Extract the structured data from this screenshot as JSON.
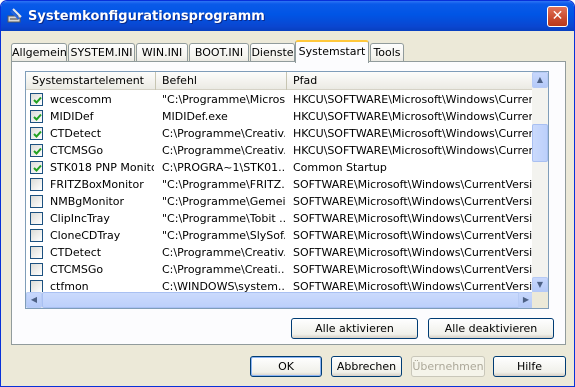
{
  "window": {
    "title": "Systemkonfigurationsprogramm",
    "close_icon": "close-icon",
    "app_icon": "msconfig-icon"
  },
  "tabs": [
    {
      "label": "Allgemein",
      "active": false
    },
    {
      "label": "SYSTEM.INI",
      "active": false
    },
    {
      "label": "WIN.INI",
      "active": false
    },
    {
      "label": "BOOT.INI",
      "active": false
    },
    {
      "label": "Dienste",
      "active": false
    },
    {
      "label": "Systemstart",
      "active": true
    },
    {
      "label": "Tools",
      "active": false
    }
  ],
  "list": {
    "columns": [
      "Systemstartelement",
      "Befehl",
      "Pfad"
    ],
    "rows": [
      {
        "checked": true,
        "name": "wcescomm",
        "command": "\"C:\\Programme\\Micros...",
        "path": "HKCU\\SOFTWARE\\Microsoft\\Windows\\CurrentVer..."
      },
      {
        "checked": true,
        "name": "MIDIDef",
        "command": "MIDIDef.exe",
        "path": "HKCU\\SOFTWARE\\Microsoft\\Windows\\CurrentVer..."
      },
      {
        "checked": true,
        "name": "CTDetect",
        "command": "C:\\Programme\\Creativ...",
        "path": "HKCU\\SOFTWARE\\Microsoft\\Windows\\CurrentVer..."
      },
      {
        "checked": true,
        "name": "CTCMSGo",
        "command": "C:\\Programme\\Creativ...",
        "path": "HKCU\\SOFTWARE\\Microsoft\\Windows\\CurrentVer..."
      },
      {
        "checked": true,
        "name": "STK018 PNP Monitor",
        "command": "C:\\PROGRA~1\\STK01...",
        "path": "Common Startup"
      },
      {
        "checked": false,
        "name": "FRITZBoxMonitor",
        "command": "\"C:\\Programme\\FRITZ...",
        "path": "SOFTWARE\\Microsoft\\Windows\\CurrentVersion\\Ru"
      },
      {
        "checked": false,
        "name": "NMBgMonitor",
        "command": "\"C:\\Programme\\Gemei...",
        "path": "SOFTWARE\\Microsoft\\Windows\\CurrentVersion\\Ru"
      },
      {
        "checked": false,
        "name": "ClipIncTray",
        "command": "\"C:\\Programme\\Tobit ...",
        "path": "SOFTWARE\\Microsoft\\Windows\\CurrentVersion\\Ru"
      },
      {
        "checked": false,
        "name": "CloneCDTray",
        "command": "\"C:\\Programme\\SlySof...",
        "path": "SOFTWARE\\Microsoft\\Windows\\CurrentVersion\\Ru"
      },
      {
        "checked": false,
        "name": "CTDetect",
        "command": "C:\\Programme\\Creativ...",
        "path": "SOFTWARE\\Microsoft\\Windows\\CurrentVersion\\Ru"
      },
      {
        "checked": false,
        "name": "CTCMSGo",
        "command": "C:\\Programme\\Creati...",
        "path": "SOFTWARE\\Microsoft\\Windows\\CurrentVersion\\Ru"
      },
      {
        "checked": false,
        "name": "ctfmon",
        "command": "C:\\WINDOWS\\system...",
        "path": "SOFTWARE\\Microsoft\\Windows\\CurrentVersion\\Ru"
      }
    ]
  },
  "panel_buttons": {
    "enable_all": "Alle aktivieren",
    "disable_all": "Alle deaktivieren"
  },
  "dialog_buttons": {
    "ok": "OK",
    "cancel": "Abbrechen",
    "apply": "Übernehmen",
    "help": "Hilfe"
  },
  "colors": {
    "titlebar": "#0055e5",
    "face": "#ece9d8",
    "active_tab_accent": "#ffc83c",
    "checkmark": "#21a121"
  }
}
